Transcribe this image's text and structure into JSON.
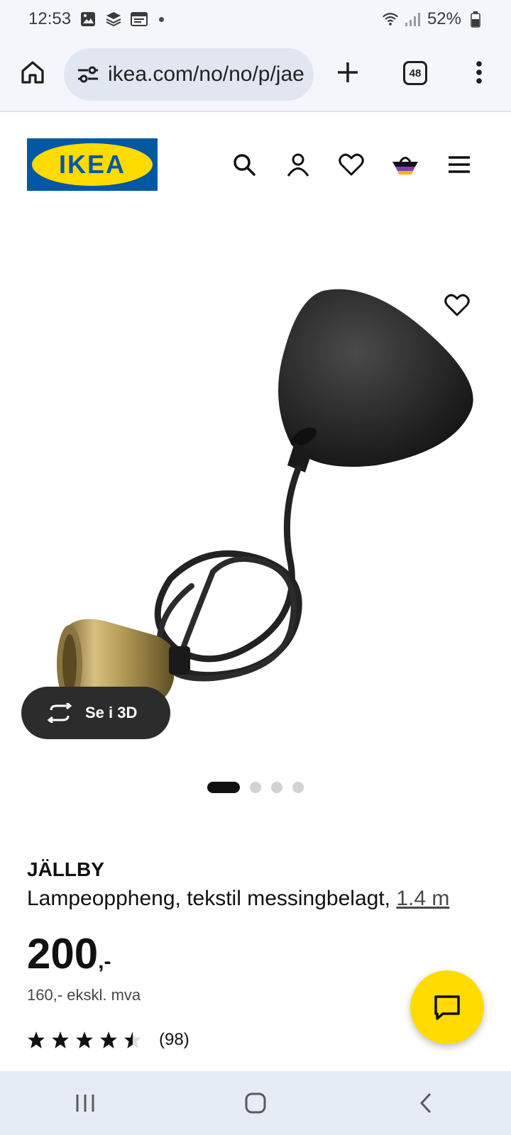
{
  "status_bar": {
    "time": "12:53",
    "battery": "52%",
    "icons": [
      "image-icon",
      "layers-icon",
      "news-icon",
      "dot-icon",
      "wifi-icon",
      "signal-icon",
      "battery-icon"
    ]
  },
  "browser": {
    "url": "ikea.com/no/no/p/jae",
    "tab_count": "48"
  },
  "site": {
    "logo_text": "IKEA",
    "header_icons": [
      "search-icon",
      "user-icon",
      "heart-icon",
      "basket-icon",
      "hamburger-menu-icon"
    ],
    "brand_colors": {
      "blue": "#0058a3",
      "yellow": "#ffdb00"
    }
  },
  "product": {
    "view3d_label": "Se i 3D",
    "carousel": {
      "total": 4,
      "active": 1
    },
    "name": "JÄLLBY",
    "description": "Lampeoppheng, tekstil messingbelagt, ",
    "measure": "1.4 m",
    "price_main": "200",
    "price_suffix": ",-",
    "price_ex_vat": "160,- ekskl. mva",
    "rating": 4.5,
    "rating_count": "(98)"
  },
  "nav": {
    "buttons": [
      "recents-icon",
      "home-icon",
      "back-icon"
    ]
  }
}
